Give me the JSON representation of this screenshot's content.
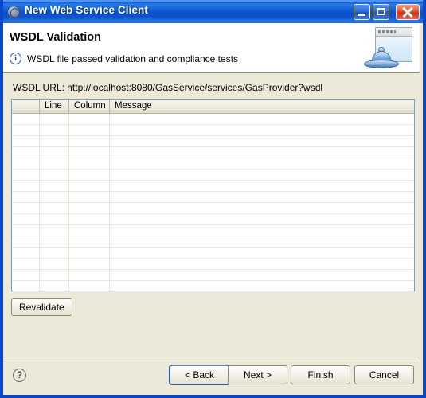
{
  "window": {
    "title": "New Web Service Client",
    "app_icon": "web-service-icon",
    "controls": {
      "minimize": "minimize-icon",
      "maximize": "maximize-icon",
      "close": "close-icon"
    }
  },
  "header": {
    "title": "WSDL Validation",
    "status_icon": "info-icon",
    "status_glyph": "i",
    "message": "WSDL file passed validation and compliance tests",
    "banner_icon": "web-service-banner-icon"
  },
  "main": {
    "url_label": "WSDL URL:",
    "url_value": "http://localhost:8080/GasService/services/GasProvider?wsdl",
    "table": {
      "columns": [
        "",
        "Line",
        "Column",
        "Message"
      ],
      "rows": []
    },
    "revalidate_label": "Revalidate"
  },
  "footer": {
    "help_glyph": "?",
    "help_icon": "help-icon",
    "buttons": [
      {
        "label": "< Back",
        "name": "back-button",
        "default": true
      },
      {
        "label": "Next >",
        "name": "next-button",
        "default": false
      },
      {
        "label": "Finish",
        "name": "finish-button",
        "default": false
      },
      {
        "label": "Cancel",
        "name": "cancel-button",
        "default": false
      }
    ]
  },
  "colors": {
    "titlebar_blue": "#0a46c8",
    "dialog_bg": "#ece9d8",
    "table_bg": "#ffffff",
    "accent_border": "#7f9db9",
    "close_red": "#c8341a"
  }
}
